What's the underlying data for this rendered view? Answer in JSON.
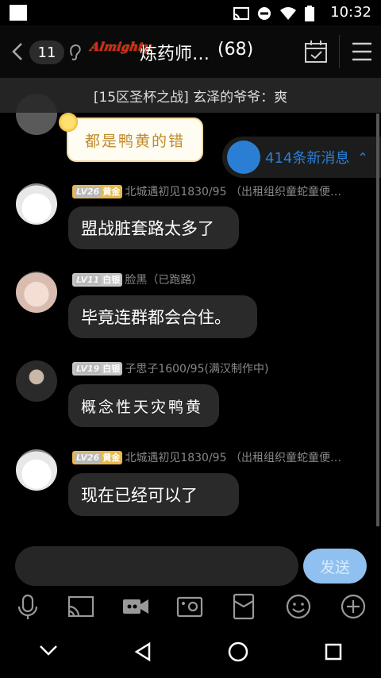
{
  "status_bar": {
    "time": "10:32"
  },
  "header": {
    "unread_badge": "11",
    "logo_text": "Almighty",
    "title": "炼药师…",
    "member_count": "(68)"
  },
  "pinned": {
    "text": "[15区圣杯之战] 玄泽的爷爷：爽"
  },
  "sticker": {
    "text": "都是鸭黄的错"
  },
  "new_messages": {
    "label": "414条新消息"
  },
  "messages": [
    {
      "level": "LV26",
      "rank": "黄金",
      "sender": "北城遇初见1830/95 （出租组织童蛇童便…",
      "text": "盟战脏套路太多了"
    },
    {
      "level": "LV11",
      "rank": "白银",
      "sender": "脸黑（已跑路）",
      "text": "毕竟连群都会合住。"
    },
    {
      "level": "LV19",
      "rank": "白银",
      "sender": "子思子1600/95(满汉制作中)",
      "text": "概念性天灾鸭黄"
    },
    {
      "level": "LV26",
      "rank": "黄金",
      "sender": "北城遇初见1830/95 （出租组织童蛇童便…",
      "text": "现在已经可以了"
    }
  ],
  "input": {
    "placeholder": "",
    "send_label": "发送"
  },
  "colors": {
    "accent": "#2a7fd4",
    "gold_rank": "#e8b84a",
    "send_disabled": "#8fc0ef"
  }
}
